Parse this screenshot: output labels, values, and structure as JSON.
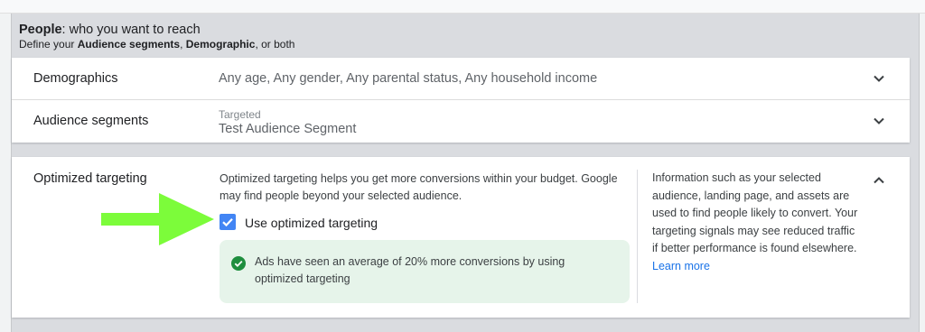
{
  "header": {
    "title_bold": "People",
    "title_rest": ": who you want to reach",
    "subtitle_pre": "Define your ",
    "subtitle_bold1": "Audience segments",
    "subtitle_mid": ", ",
    "subtitle_bold2": "Demographic",
    "subtitle_post": ", or both"
  },
  "demographics": {
    "label": "Demographics",
    "value": "Any age, Any gender, Any parental status, Any household income"
  },
  "audience": {
    "label": "Audience segments",
    "small_label": "Targeted",
    "value": "Test Audience Segment"
  },
  "optimized": {
    "label": "Optimized targeting",
    "description": "Optimized targeting helps you get more conversions within your budget. Google may find people beyond your selected audience.",
    "checkbox_label": "Use optimized targeting",
    "checked": true,
    "success_text": "Ads have seen an average of 20% more conversions by using optimized targeting",
    "info_text": "Information such as your selected audience, landing page, and assets are used to find people likely to convert. Your targeting signals may see reduced traffic if better performance is found elsewhere.",
    "learn_more": "Learn more"
  },
  "colors": {
    "accent": "#4285f4",
    "link": "#1a73e8",
    "success_bg": "#e6f4ea",
    "success_icon": "#1e8e3e",
    "arrow": "#7cfc3a"
  }
}
